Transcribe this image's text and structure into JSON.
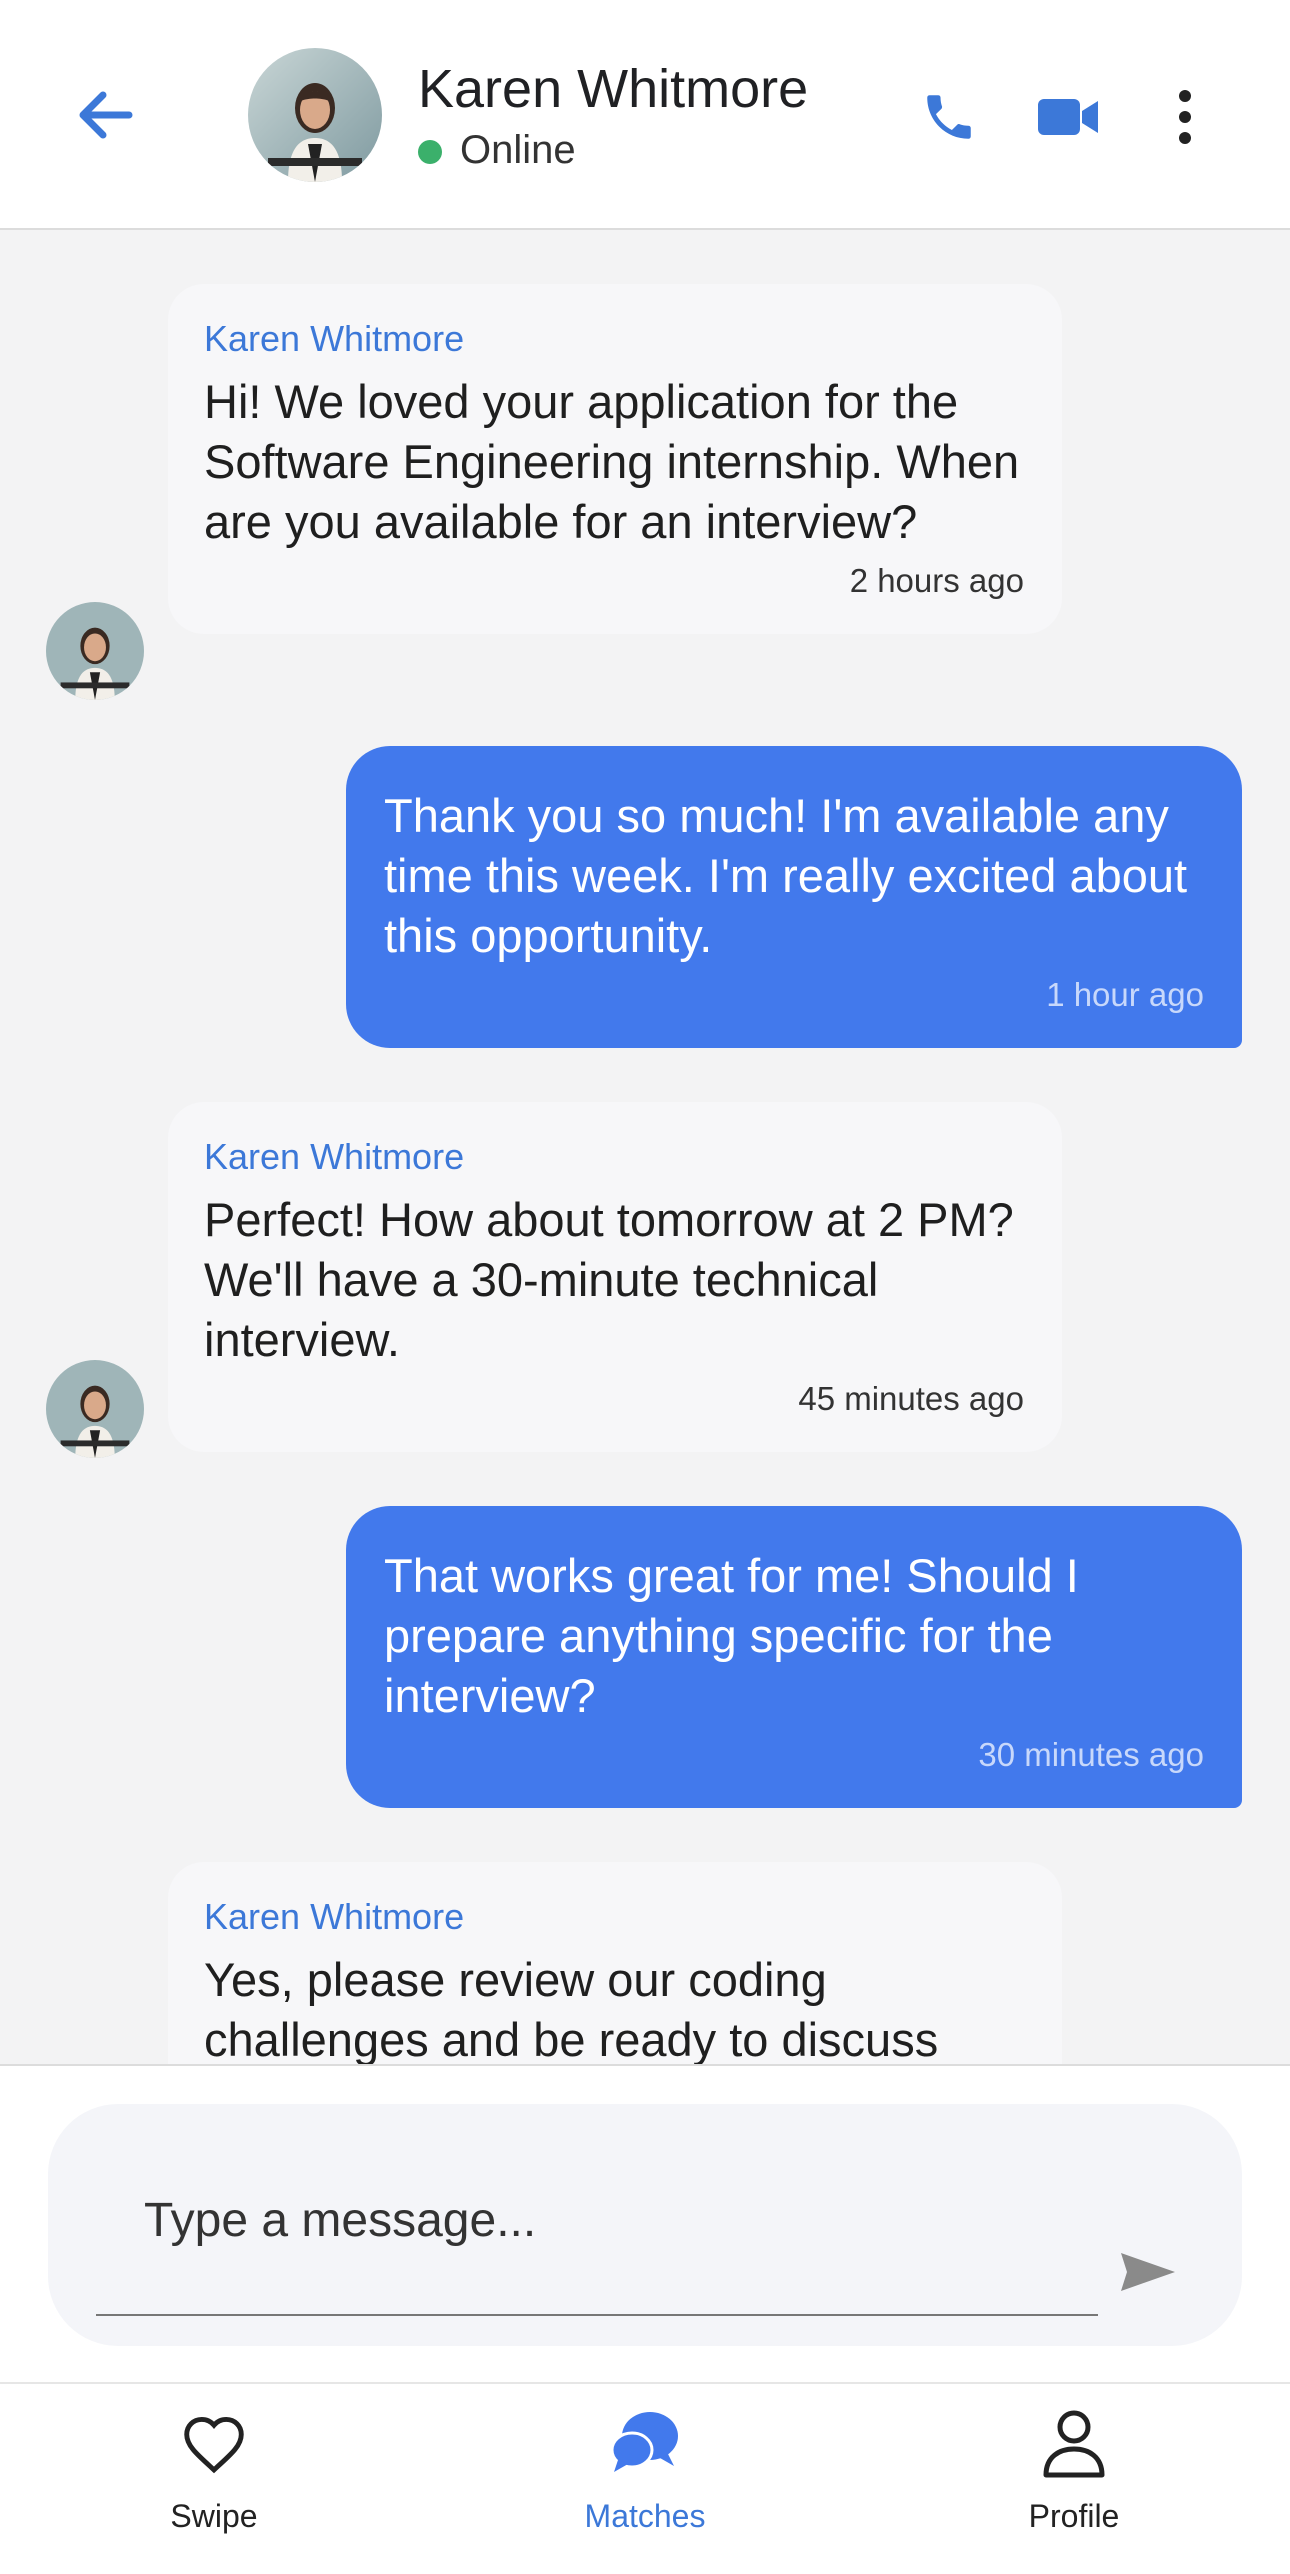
{
  "header": {
    "name": "Karen Whitmore",
    "status": "Online"
  },
  "messages": [
    {
      "direction": "in",
      "sender": "Karen Whitmore",
      "text": "Hi! We loved your application for the Software Engineering internship. When are you available for an interview?",
      "time": "2 hours ago"
    },
    {
      "direction": "out",
      "text": "Thank you so much! I'm available any time this week. I'm really excited about this opportunity.",
      "time": "1 hour ago"
    },
    {
      "direction": "in",
      "sender": "Karen Whitmore",
      "text": "Perfect! How about tomorrow at 2 PM? We'll have a 30-minute technical interview.",
      "time": "45 minutes ago"
    },
    {
      "direction": "out",
      "text": "That works great for me! Should I prepare anything specific for the interview?",
      "time": "30 minutes ago"
    },
    {
      "direction": "in",
      "sender": "Karen Whitmore",
      "text": "Yes, please review our coding challenges and be ready to discuss"
    }
  ],
  "composer": {
    "placeholder": "Type a message..."
  },
  "nav": {
    "items": [
      {
        "label": "Swipe",
        "icon": "heart-icon",
        "active": false
      },
      {
        "label": "Matches",
        "icon": "chat-bubbles-icon",
        "active": true
      },
      {
        "label": "Profile",
        "icon": "person-icon",
        "active": false
      }
    ]
  },
  "colors": {
    "accent": "#4279ec",
    "link": "#3c78d8",
    "online": "#3bb06b"
  }
}
